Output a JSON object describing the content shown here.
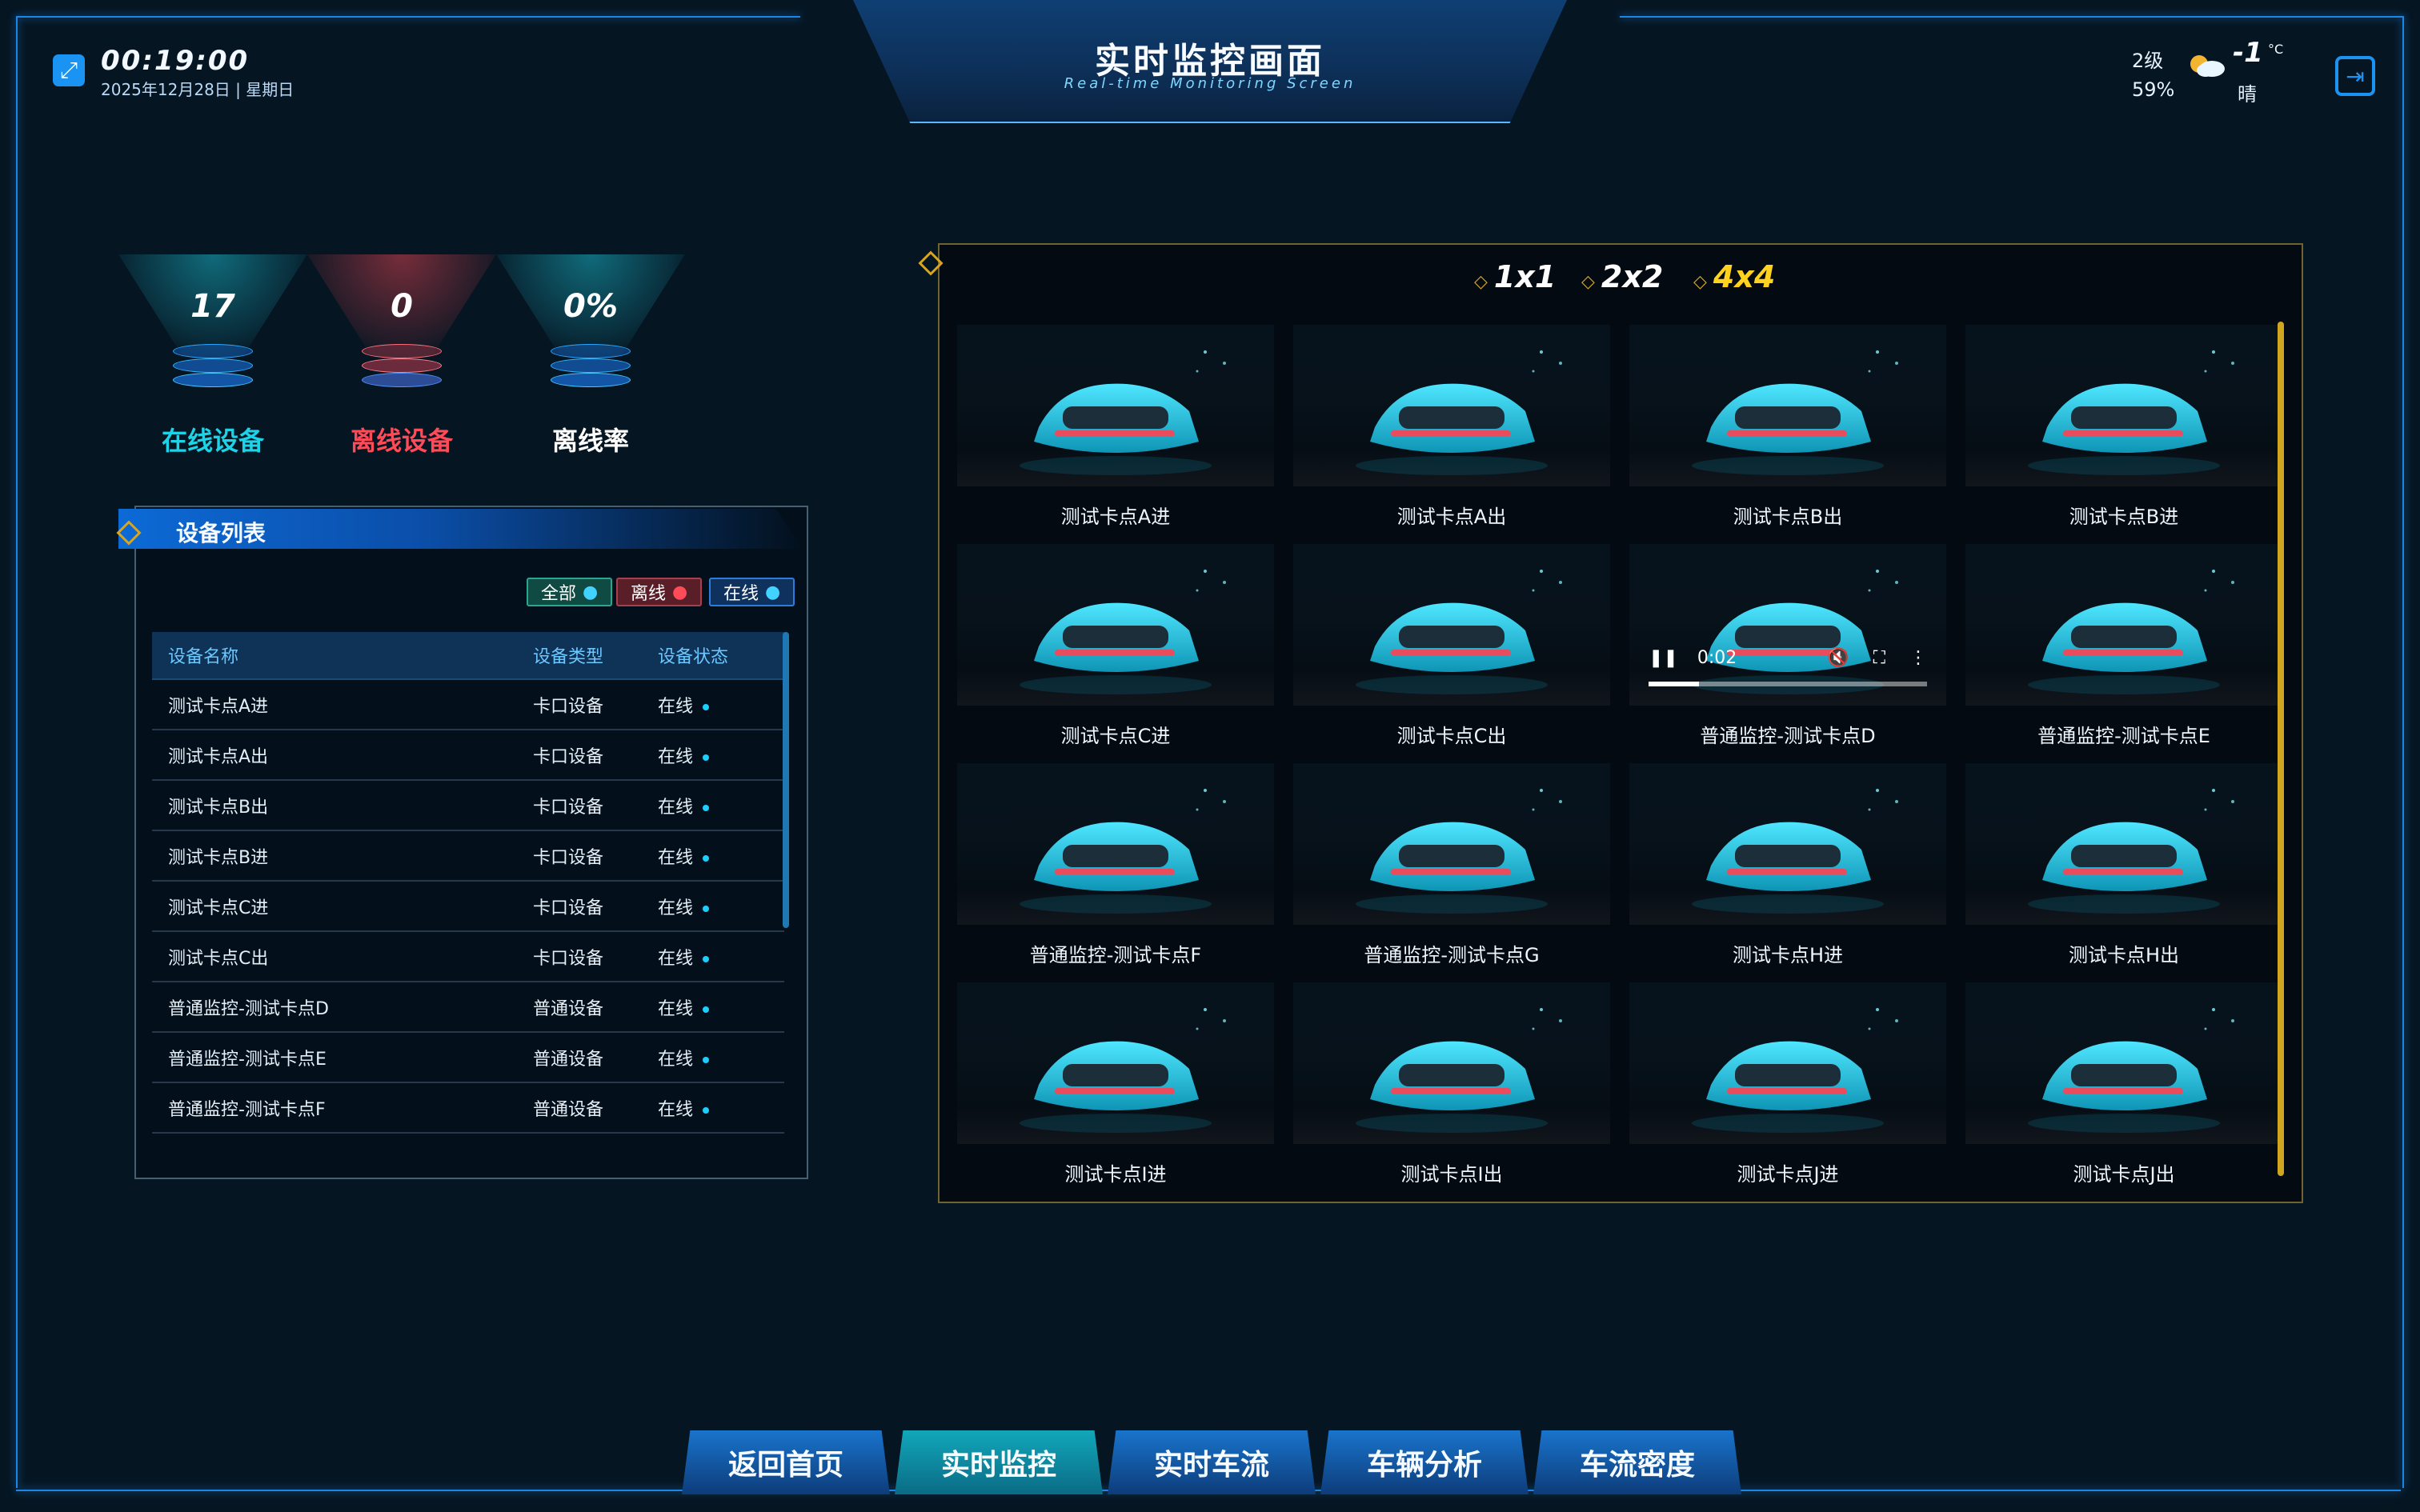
{
  "header": {
    "time": "00:19:00",
    "date": "2025年12月28日 | 星期日",
    "title": "实时监控画面",
    "subtitle": "Real-time Monitoring Screen",
    "weather": {
      "wind": "2级",
      "humidity": "59%",
      "temperature": "-1",
      "unit": "°C",
      "condition": "晴"
    }
  },
  "stats": [
    {
      "value": "17",
      "label": "在线设备",
      "color": "#1dd3e7"
    },
    {
      "value": "0",
      "label": "离线设备",
      "color": "#ff4a57"
    },
    {
      "value": "0%",
      "label": "离线率",
      "color": "#ffffff"
    }
  ],
  "device_panel": {
    "title": "设备列表",
    "filters": [
      "全部",
      "离线",
      "在线"
    ],
    "columns": [
      "设备名称",
      "设备类型",
      "设备状态"
    ],
    "rows": [
      [
        "测试卡点A进",
        "卡口设备",
        "在线"
      ],
      [
        "测试卡点A出",
        "卡口设备",
        "在线"
      ],
      [
        "测试卡点B出",
        "卡口设备",
        "在线"
      ],
      [
        "测试卡点B进",
        "卡口设备",
        "在线"
      ],
      [
        "测试卡点C进",
        "卡口设备",
        "在线"
      ],
      [
        "测试卡点C出",
        "卡口设备",
        "在线"
      ],
      [
        "普通监控-测试卡点D",
        "普通设备",
        "在线"
      ],
      [
        "普通监控-测试卡点E",
        "普通设备",
        "在线"
      ],
      [
        "普通监控-测试卡点F",
        "普通设备",
        "在线"
      ]
    ]
  },
  "video_panel": {
    "layouts": [
      "1x1",
      "2x2",
      "4x4"
    ],
    "active_layout": "4x4",
    "video_time": "0:02",
    "tiles": [
      "测试卡点A进",
      "测试卡点A出",
      "测试卡点B出",
      "测试卡点B进",
      "测试卡点C进",
      "测试卡点C出",
      "普通监控-测试卡点D",
      "普通监控-测试卡点E",
      "普通监控-测试卡点F",
      "普通监控-测试卡点G",
      "测试卡点H进",
      "测试卡点H出",
      "测试卡点I进",
      "测试卡点I出",
      "测试卡点J进",
      "测试卡点J出"
    ]
  },
  "bottom_nav": [
    "返回首页",
    "实时监控",
    "实时车流",
    "车辆分析",
    "车流密度"
  ],
  "colors": {
    "accent_blue": "#1a93f3",
    "accent_cyan": "#1dd3e7",
    "accent_red": "#ff4a57",
    "accent_gold": "#d8a51d",
    "online": "#1ad0ff"
  }
}
